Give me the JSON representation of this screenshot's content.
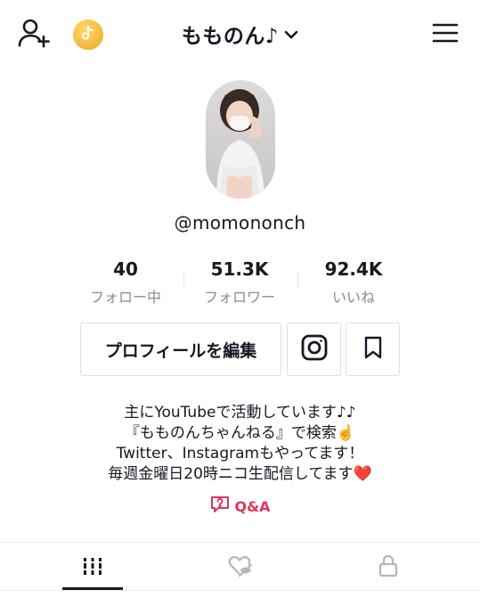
{
  "header": {
    "username_title": "もものん♪",
    "icons": [
      "add-user-icon",
      "tiktok-coin-icon",
      "chevron-down-icon",
      "hamburger-menu-icon"
    ]
  },
  "profile": {
    "handle": "@momononch",
    "stats": [
      {
        "value": "40",
        "label": "フォロー中"
      },
      {
        "value": "51.3K",
        "label": "フォロワー"
      },
      {
        "value": "92.4K",
        "label": "いいね"
      }
    ]
  },
  "actions": {
    "edit_profile_label": "プロフィールを編集",
    "icons": [
      "instagram-icon",
      "bookmark-icon"
    ]
  },
  "bio": {
    "lines": [
      "主にYouTubeで活動しています♪♪",
      "『もものんちゃんねる』で検索☝️",
      "Twitter、Instagramもやってます！",
      "毎週金曜日20時ニコ生配信してます❤️"
    ],
    "qa_label": "Q&A"
  },
  "tabs": {
    "items": [
      {
        "icon": "grid-videos-icon",
        "active": true
      },
      {
        "icon": "liked-hidden-icon",
        "active": false
      },
      {
        "icon": "lock-icon",
        "active": false
      }
    ]
  },
  "colors": {
    "text": "#161823",
    "muted": "#8a8b91",
    "accent_pink": "#e0345d",
    "coin_gold": "#f2b638"
  }
}
